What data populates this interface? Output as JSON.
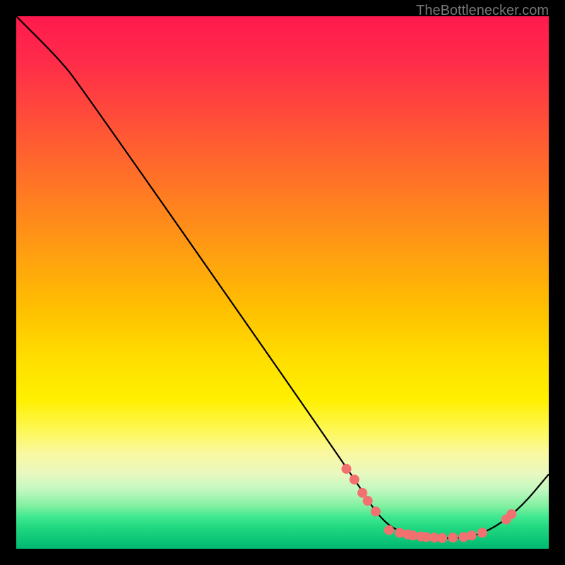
{
  "watermark": "TheBottlenecker.com",
  "chart_data": {
    "type": "line",
    "title": "",
    "xlabel": "",
    "ylabel": "",
    "xlim": [
      0,
      100
    ],
    "ylim": [
      0,
      100
    ],
    "curve": [
      {
        "x": 0,
        "y": 100
      },
      {
        "x": 8,
        "y": 92
      },
      {
        "x": 12,
        "y": 87
      },
      {
        "x": 63,
        "y": 14
      },
      {
        "x": 68,
        "y": 6
      },
      {
        "x": 72,
        "y": 3
      },
      {
        "x": 78,
        "y": 2
      },
      {
        "x": 85,
        "y": 2
      },
      {
        "x": 90,
        "y": 4
      },
      {
        "x": 95,
        "y": 8
      },
      {
        "x": 100,
        "y": 14
      }
    ],
    "markers": [
      {
        "x": 62,
        "y": 15
      },
      {
        "x": 63.5,
        "y": 13
      },
      {
        "x": 65,
        "y": 10.5
      },
      {
        "x": 66,
        "y": 9
      },
      {
        "x": 67.5,
        "y": 7
      },
      {
        "x": 70,
        "y": 3.5
      },
      {
        "x": 72,
        "y": 3
      },
      {
        "x": 73.5,
        "y": 2.7
      },
      {
        "x": 74.5,
        "y": 2.5
      },
      {
        "x": 76,
        "y": 2.3
      },
      {
        "x": 77,
        "y": 2.2
      },
      {
        "x": 78.5,
        "y": 2.1
      },
      {
        "x": 80,
        "y": 2
      },
      {
        "x": 82,
        "y": 2.1
      },
      {
        "x": 84,
        "y": 2.2
      },
      {
        "x": 85.5,
        "y": 2.5
      },
      {
        "x": 87.5,
        "y": 3
      },
      {
        "x": 92,
        "y": 5.5
      },
      {
        "x": 93,
        "y": 6.5
      }
    ],
    "marker_color": "#f27070",
    "marker_size": 7,
    "line_color": "#000000",
    "line_width": 2.2
  }
}
